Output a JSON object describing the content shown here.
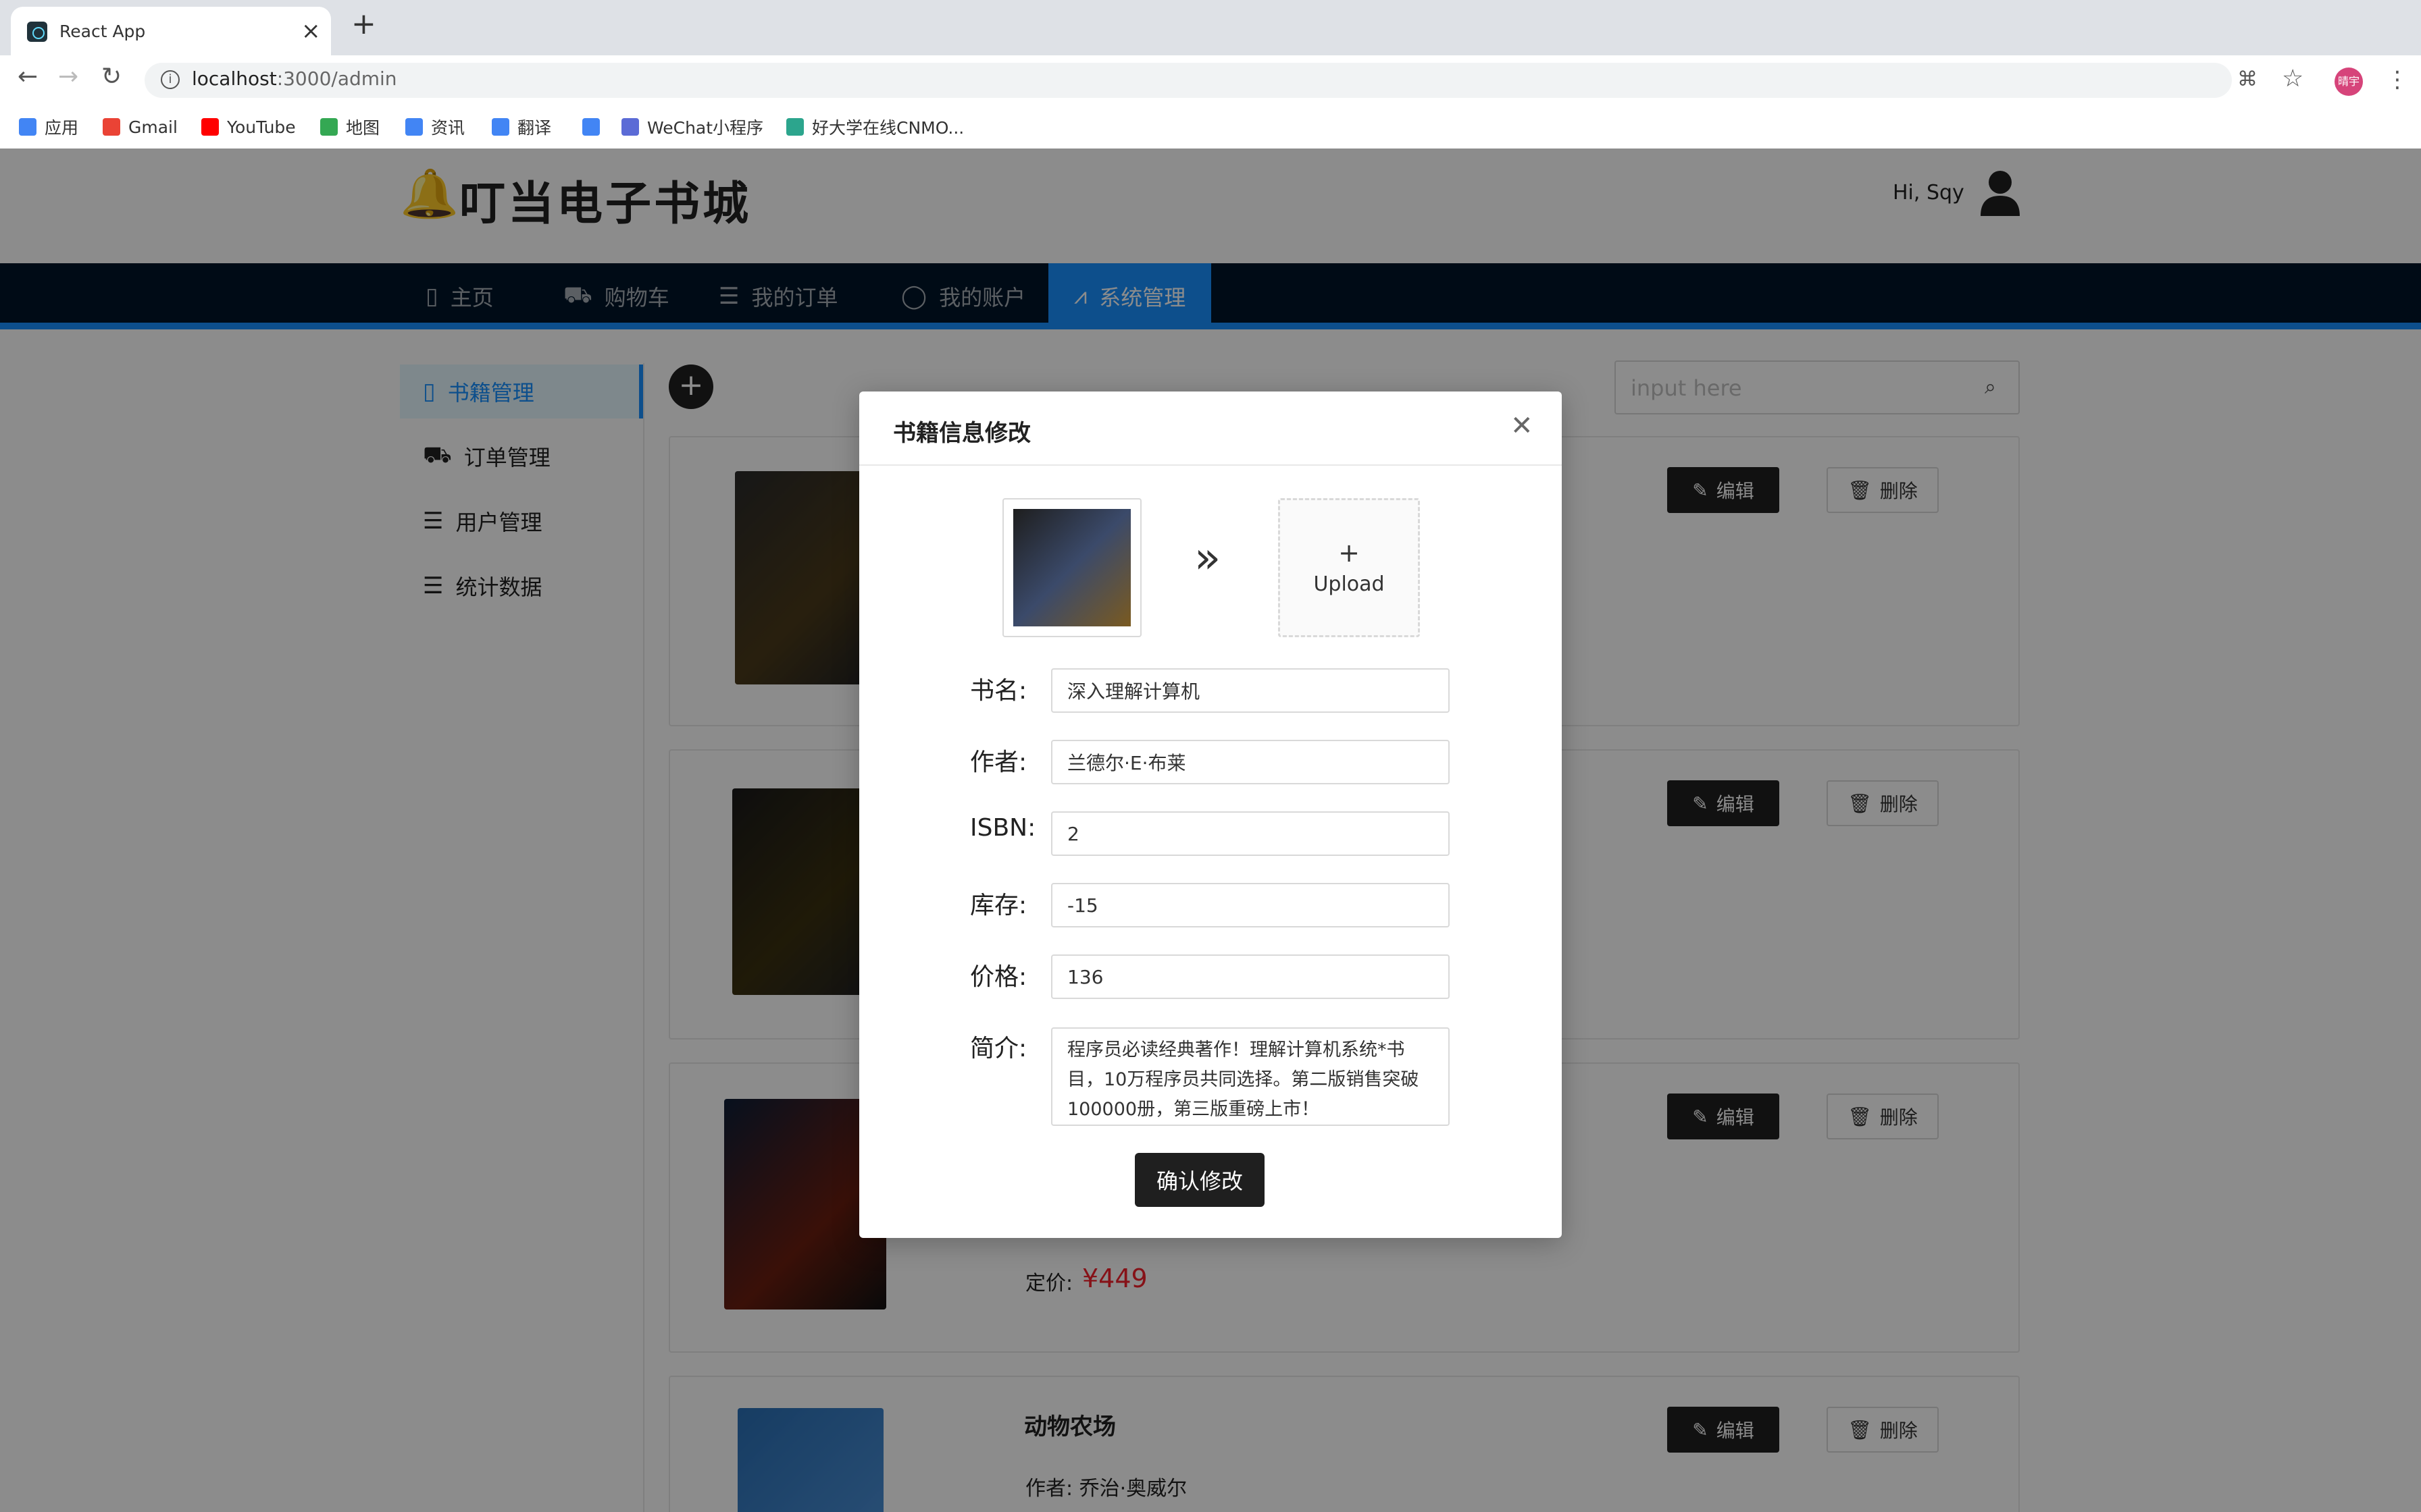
{
  "browser": {
    "tab_title": "React App",
    "url_host": "localhost",
    "url_path": ":3000/admin",
    "profile_initials": "晴宇",
    "bookmarks": [
      {
        "label": "应用",
        "icon": "apps-grid-icon",
        "color": "#4285f4"
      },
      {
        "label": "Gmail",
        "icon": "gmail-icon",
        "color": "#ea4335"
      },
      {
        "label": "YouTube",
        "icon": "youtube-icon",
        "color": "#ff0000"
      },
      {
        "label": "地图",
        "icon": "maps-icon",
        "color": "#34a853"
      },
      {
        "label": "资讯",
        "icon": "news-icon",
        "color": "#4285f4"
      },
      {
        "label": "翻译",
        "icon": "translate-icon",
        "color": "#4285f4"
      },
      {
        "label": "",
        "icon": "google-icon",
        "color": "#4285f4"
      },
      {
        "label": "WeChat小程序",
        "icon": "wechat-miniprogram-icon",
        "color": "#5b6bd6"
      },
      {
        "label": "好大学在线CNMO...",
        "icon": "cnmooc-icon",
        "color": "#2ca58d"
      }
    ]
  },
  "header": {
    "logo_text": "叮当电子书城",
    "greeting": "Hi, Sqy"
  },
  "menu": [
    {
      "label": "主页",
      "icon": "read-icon"
    },
    {
      "label": "购物车",
      "icon": "cart-icon"
    },
    {
      "label": "我的订单",
      "icon": "order-icon"
    },
    {
      "label": "我的账户",
      "icon": "user-icon"
    },
    {
      "label": "系统管理",
      "icon": "chart-icon",
      "active": true
    }
  ],
  "sidebar": [
    {
      "label": "书籍管理",
      "icon": "book-icon",
      "active": true
    },
    {
      "label": "订单管理",
      "icon": "cart-icon"
    },
    {
      "label": "用户管理",
      "icon": "profile-icon"
    },
    {
      "label": "统计数据",
      "icon": "stats-icon"
    }
  ],
  "search": {
    "placeholder": "input here"
  },
  "cards": {
    "edit_label": "编辑",
    "delete_label": "删除",
    "price_label": "定价:",
    "price_3": "¥449",
    "book4_title": "动物农场",
    "book4_author": "作者: 乔治·奥威尔"
  },
  "modal": {
    "title": "书籍信息修改",
    "upload_label": "Upload",
    "fields": {
      "name_label": "书名:",
      "name_value": "深入理解计算机",
      "author_label": "作者:",
      "author_value": "兰德尔·E·布莱",
      "isbn_label": "ISBN:",
      "isbn_value": "2",
      "stock_label": "库存:",
      "stock_value": "-15",
      "price_label": "价格:",
      "price_value": "136",
      "intro_label": "简介:",
      "intro_value": "程序员必读经典著作！理解计算机系统*书目，10万程序员共同选择。第二版销售突破100000册，第三版重磅上市！"
    },
    "confirm_label": "确认修改"
  },
  "colors": {
    "menu_bg": "#001529",
    "accent": "#1890ff",
    "price": "#f5222d"
  }
}
